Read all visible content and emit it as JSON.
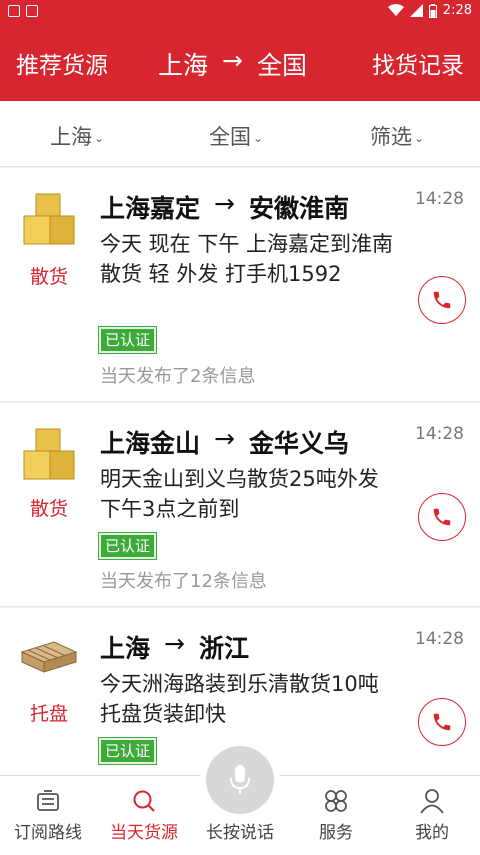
{
  "status_bar": {
    "time": "2:28"
  },
  "header": {
    "left_label": "推荐货源",
    "route_from": "上海",
    "route_arrow": "→",
    "route_to": "全国",
    "right_label": "找货记录"
  },
  "filters": [
    {
      "label": "上海"
    },
    {
      "label": "全国"
    },
    {
      "label": "筛选"
    }
  ],
  "listings": [
    {
      "type": "散货",
      "type_icon": "boxes-icon",
      "from": "上海嘉定",
      "arrow": "→",
      "to": "安徽淮南",
      "time": "14:28",
      "description": "今天 现在 下午 上海嘉定到淮南散货 轻 外发 打手机1592",
      "badge": "已认证",
      "count": "当天发布了2条信息"
    },
    {
      "type": "散货",
      "type_icon": "boxes-icon",
      "from": "上海金山",
      "arrow": "→",
      "to": "金华义乌",
      "time": "14:28",
      "description": "明天金山到义乌散货25吨外发 下午3点之前到",
      "badge": "已认证",
      "count": "当天发布了12条信息"
    },
    {
      "type": "托盘",
      "type_icon": "pallet-icon",
      "from": "上海",
      "arrow": "→",
      "to": "浙江",
      "time": "14:28",
      "description": "今天洲海路装到乐清散货10吨 托盘货装卸快",
      "badge": "已认证",
      "count": ""
    }
  ],
  "tabs": [
    {
      "label": "订阅路线",
      "icon": "subscribe-icon"
    },
    {
      "label": "当天货源",
      "icon": "search-icon",
      "active": true
    },
    {
      "label": "长按说话",
      "icon": "microphone-icon"
    },
    {
      "label": "服务",
      "icon": "grid-icon"
    },
    {
      "label": "我的",
      "icon": "user-icon"
    }
  ],
  "colors": {
    "brand_red": "#d7262f",
    "verified_green": "#3eaa3a"
  }
}
